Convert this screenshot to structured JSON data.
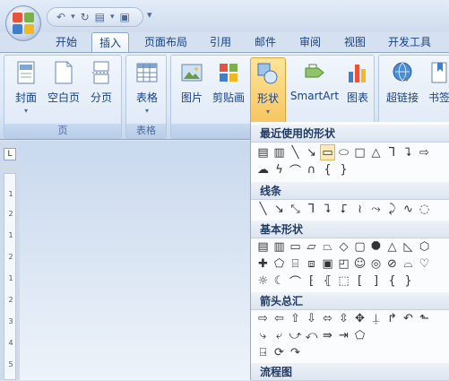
{
  "tabs": [
    "开始",
    "插入",
    "页面布局",
    "引用",
    "邮件",
    "审阅",
    "视图",
    "开发工具"
  ],
  "active_tab": "插入",
  "qat_more": "▾",
  "groups": [
    {
      "label": "页",
      "buttons": [
        "封面",
        "空白页",
        "分页"
      ]
    },
    {
      "label": "表格",
      "buttons": [
        "表格"
      ]
    },
    {
      "label": "",
      "buttons": [
        "图片",
        "剪贴画",
        "形状",
        "SmartArt",
        "图表"
      ]
    },
    {
      "label": "",
      "buttons": [
        "超链接",
        "书签"
      ]
    }
  ],
  "ruler": {
    "corner": "L",
    "ticks": [
      "1",
      "2",
      "1",
      "2",
      "1",
      "2",
      "3",
      "4",
      "5"
    ]
  },
  "menu": {
    "sections": [
      {
        "title": "最近使用的形状"
      },
      {
        "title": "线条"
      },
      {
        "title": "基本形状"
      },
      {
        "title": "箭头总汇"
      },
      {
        "title": "流程图"
      }
    ]
  },
  "colors": {
    "accent": "#f8c560",
    "ribbon": "#dbe7f6",
    "text": "#15428b"
  }
}
